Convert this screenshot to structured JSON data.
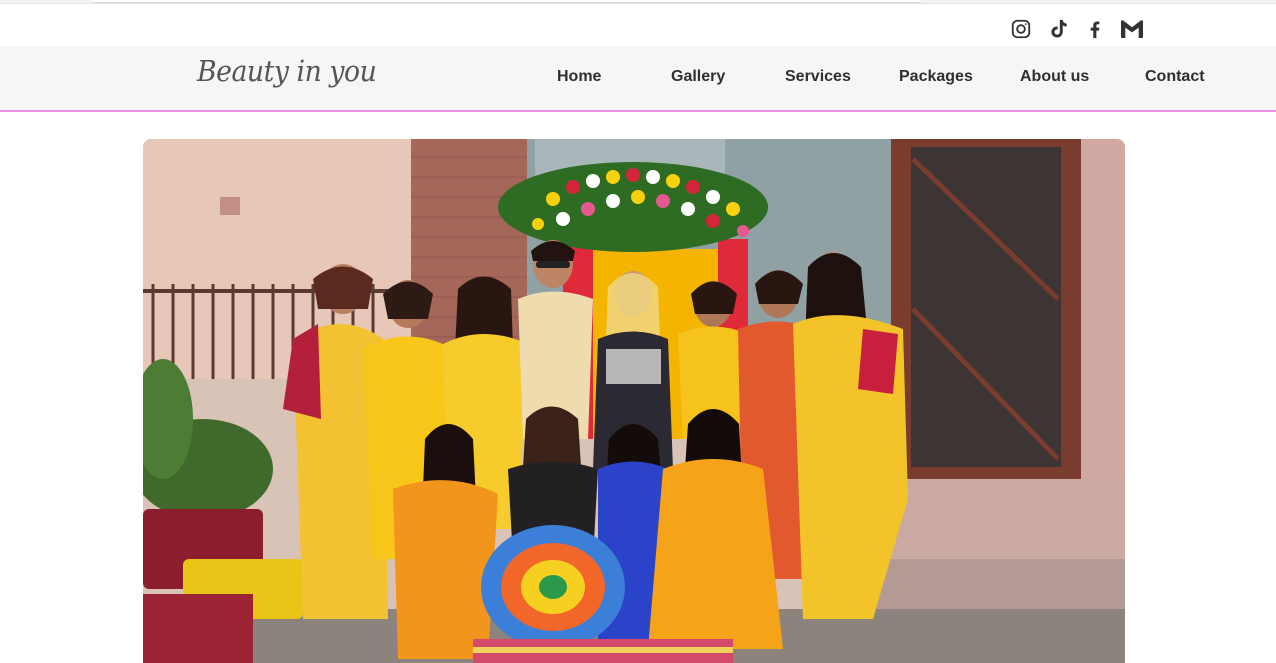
{
  "brand": {
    "logo_text": "Beauty in you"
  },
  "social": [
    {
      "name": "instagram-icon"
    },
    {
      "name": "tiktok-icon"
    },
    {
      "name": "facebook-icon"
    },
    {
      "name": "gmail-icon"
    }
  ],
  "nav": {
    "items": [
      "Home",
      "Gallery",
      "Services",
      "Packages",
      "About us",
      "Contact"
    ]
  },
  "hero": {
    "alt": "Group photo of women in yellow saris at a haldi ceremony"
  },
  "colors": {
    "nav_border": "#e58fe0",
    "text": "#2f2f2f",
    "nav_bg": "#f6f6f6"
  }
}
